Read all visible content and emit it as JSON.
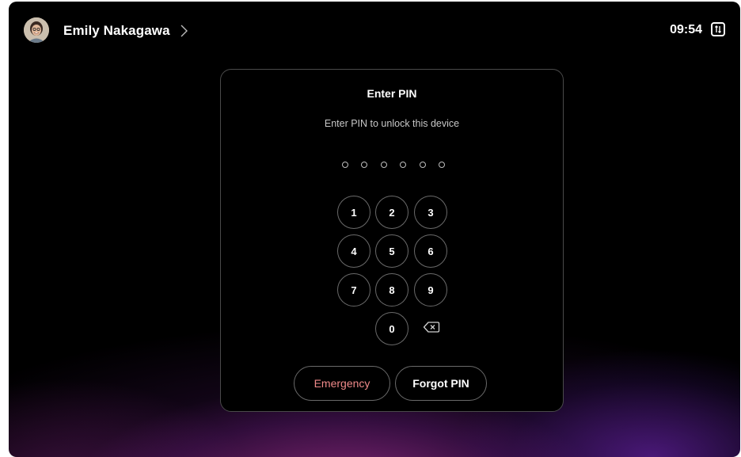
{
  "header": {
    "user_name": "Emily Nakagawa",
    "time": "09:54",
    "icons": {
      "avatar": "user-avatar",
      "chevron": "chevron-right-icon",
      "status": "sort-arrows-icon"
    }
  },
  "pin_dialog": {
    "title": "Enter PIN",
    "subtitle": "Enter PIN to unlock this device",
    "pin_length": 6,
    "entered_digits": 0,
    "keys": [
      "1",
      "2",
      "3",
      "4",
      "5",
      "6",
      "7",
      "8",
      "9",
      "0"
    ],
    "backspace_icon": "backspace-icon",
    "emergency_label": "Emergency",
    "forgot_label": "Forgot PIN"
  },
  "colors": {
    "background": "#000000",
    "card_border": "#4a4a4a",
    "key_border": "#6a6a6a",
    "emergency_text": "#f08a8a",
    "glow_pink": "#c83ca0",
    "glow_purple": "#7828c8"
  }
}
